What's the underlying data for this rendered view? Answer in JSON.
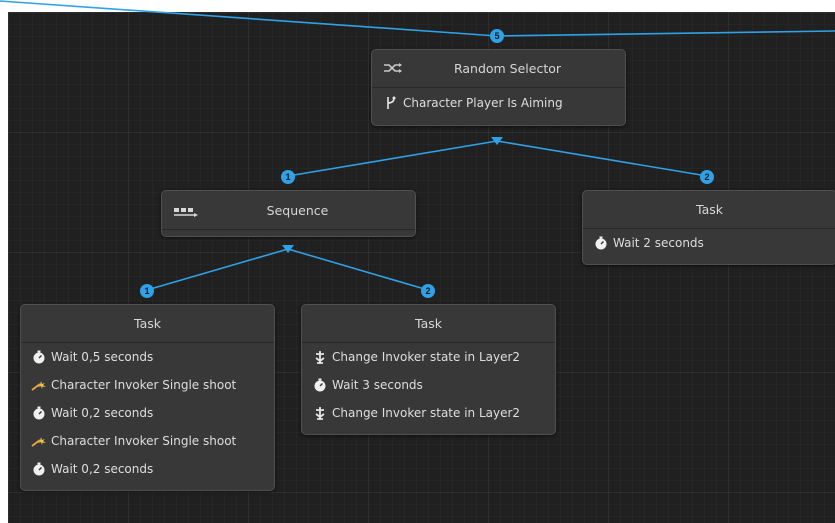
{
  "colors": {
    "link": "#2fa1e6",
    "background": "#202020",
    "node": "#383838"
  },
  "nodes": {
    "random_selector": {
      "title": "Random Selector",
      "icon": "random-selector-icon",
      "condition": {
        "icon": "condition-fork-icon",
        "text": "Character Player Is Aiming"
      },
      "badge": "5"
    },
    "sequence": {
      "title": "Sequence",
      "icon": "sequence-icon",
      "badge": "1"
    },
    "task_right": {
      "title": "Task",
      "badge": "2",
      "rows": [
        {
          "icon": "stopwatch-icon",
          "text": "Wait 2 seconds"
        }
      ]
    },
    "task_left": {
      "title": "Task",
      "badge": "1",
      "rows": [
        {
          "icon": "stopwatch-icon",
          "text": "Wait 0,5 seconds"
        },
        {
          "icon": "shoot-icon",
          "text": "Character Invoker Single shoot"
        },
        {
          "icon": "stopwatch-icon",
          "text": "Wait 0,2 seconds"
        },
        {
          "icon": "shoot-icon",
          "text": "Character Invoker Single shoot"
        },
        {
          "icon": "stopwatch-icon",
          "text": "Wait 0,2 seconds"
        }
      ]
    },
    "task_middle": {
      "title": "Task",
      "badge": "2",
      "rows": [
        {
          "icon": "state-change-icon",
          "text": "Change Invoker state in Layer2"
        },
        {
          "icon": "stopwatch-icon",
          "text": "Wait 3 seconds"
        },
        {
          "icon": "state-change-icon",
          "text": "Change Invoker state in Layer2"
        }
      ]
    }
  }
}
